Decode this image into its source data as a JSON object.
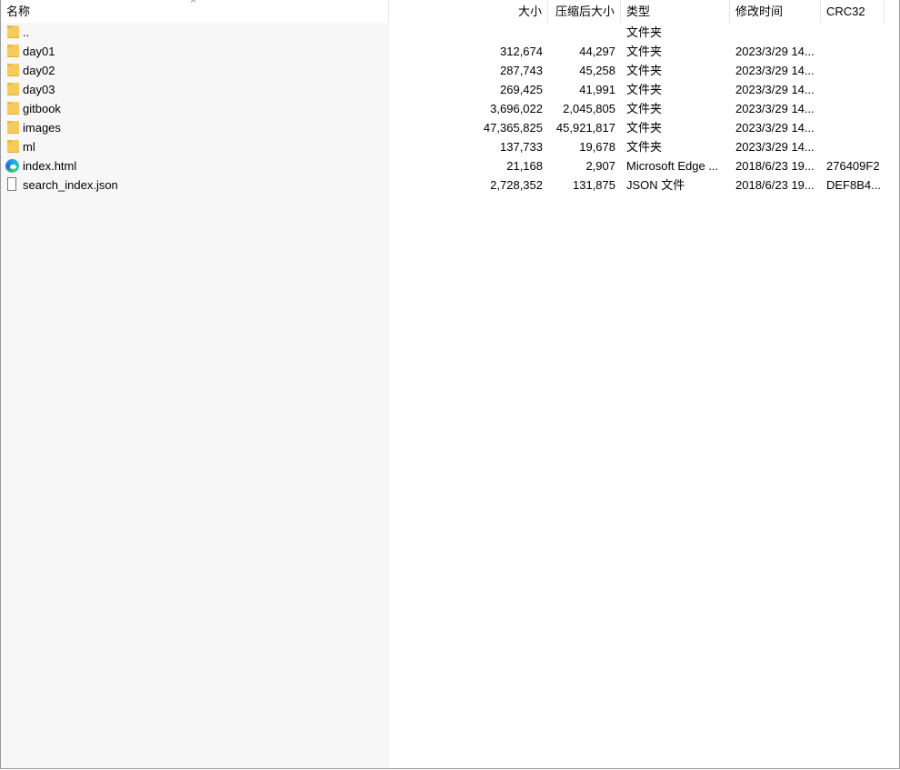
{
  "columns": {
    "name": "名称",
    "size": "大小",
    "packed": "压缩后大小",
    "type": "类型",
    "modified": "修改时间",
    "crc": "CRC32"
  },
  "rows": [
    {
      "icon": "folder-icon",
      "name": "..",
      "size": "",
      "packed": "",
      "type": "文件夹",
      "modified": "",
      "crc": ""
    },
    {
      "icon": "folder-icon",
      "name": "day01",
      "size": "312,674",
      "packed": "44,297",
      "type": "文件夹",
      "modified": "2023/3/29 14...",
      "crc": ""
    },
    {
      "icon": "folder-icon",
      "name": "day02",
      "size": "287,743",
      "packed": "45,258",
      "type": "文件夹",
      "modified": "2023/3/29 14...",
      "crc": ""
    },
    {
      "icon": "folder-icon",
      "name": "day03",
      "size": "269,425",
      "packed": "41,991",
      "type": "文件夹",
      "modified": "2023/3/29 14...",
      "crc": ""
    },
    {
      "icon": "folder-icon",
      "name": "gitbook",
      "size": "3,696,022",
      "packed": "2,045,805",
      "type": "文件夹",
      "modified": "2023/3/29 14...",
      "crc": ""
    },
    {
      "icon": "folder-icon",
      "name": "images",
      "size": "47,365,825",
      "packed": "45,921,817",
      "type": "文件夹",
      "modified": "2023/3/29 14...",
      "crc": ""
    },
    {
      "icon": "folder-icon",
      "name": "ml",
      "size": "137,733",
      "packed": "19,678",
      "type": "文件夹",
      "modified": "2023/3/29 14...",
      "crc": ""
    },
    {
      "icon": "edge-icon",
      "name": "index.html",
      "size": "21,168",
      "packed": "2,907",
      "type": "Microsoft Edge ...",
      "modified": "2018/6/23 19...",
      "crc": "276409F2"
    },
    {
      "icon": "file-icon",
      "name": "search_index.json",
      "size": "2,728,352",
      "packed": "131,875",
      "type": "JSON 文件",
      "modified": "2018/6/23 19...",
      "crc": "DEF8B4..."
    }
  ],
  "sort_icon": "sort-up-icon"
}
